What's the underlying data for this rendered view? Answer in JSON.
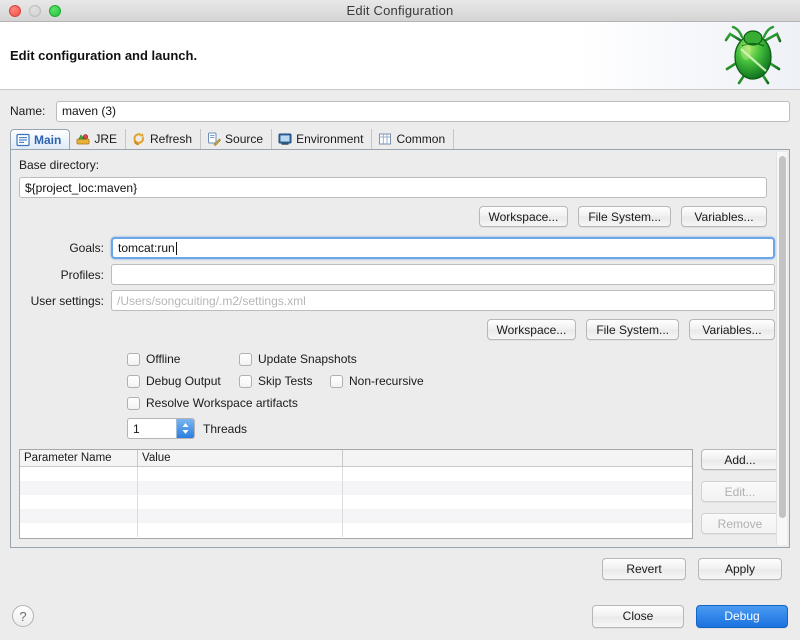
{
  "window": {
    "title": "Edit Configuration",
    "traffic_lights": [
      "close-button",
      "minimize-button",
      "zoom-button"
    ]
  },
  "header": {
    "title": "Edit configuration and launch.",
    "icon": "debug-bug-icon"
  },
  "name_field": {
    "label": "Name:",
    "value": "maven (3)"
  },
  "tabs": [
    {
      "label": "Main",
      "icon": "main-tab-icon",
      "active": true
    },
    {
      "label": "JRE",
      "icon": "jre-tab-icon",
      "active": false
    },
    {
      "label": "Refresh",
      "icon": "refresh-tab-icon",
      "active": false
    },
    {
      "label": "Source",
      "icon": "source-tab-icon",
      "active": false
    },
    {
      "label": "Environment",
      "icon": "environment-tab-icon",
      "active": false
    },
    {
      "label": "Common",
      "icon": "common-tab-icon",
      "active": false
    }
  ],
  "main_tab": {
    "base_directory": {
      "label": "Base directory:",
      "value": "${project_loc:maven}"
    },
    "locator_buttons_top": [
      {
        "label": "Workspace..."
      },
      {
        "label": "File System..."
      },
      {
        "label": "Variables..."
      }
    ],
    "goals": {
      "label": "Goals:",
      "value": "tomcat:run",
      "focused": true
    },
    "profiles": {
      "label": "Profiles:",
      "value": ""
    },
    "user_settings": {
      "label": "User settings:",
      "value": "",
      "placeholder": "/Users/songcuiting/.m2/settings.xml"
    },
    "locator_buttons_bottom": [
      {
        "label": "Workspace..."
      },
      {
        "label": "File System..."
      },
      {
        "label": "Variables..."
      }
    ],
    "checkboxes": [
      [
        {
          "label": "Offline",
          "checked": false
        },
        {
          "label": "Update Snapshots",
          "checked": false
        }
      ],
      [
        {
          "label": "Debug Output",
          "checked": false
        },
        {
          "label": "Skip Tests",
          "checked": false
        },
        {
          "label": "Non-recursive",
          "checked": false
        }
      ],
      [
        {
          "label": "Resolve Workspace artifacts",
          "checked": false
        }
      ]
    ],
    "threads": {
      "value": "1",
      "label": "Threads"
    },
    "parameters_table": {
      "columns": [
        "Parameter Name",
        "Value",
        ""
      ],
      "rows": []
    },
    "table_buttons": [
      {
        "label": "Add...",
        "enabled": true
      },
      {
        "label": "Edit...",
        "enabled": false
      },
      {
        "label": "Remove",
        "enabled": false
      }
    ]
  },
  "action_buttons": [
    {
      "label": "Revert"
    },
    {
      "label": "Apply"
    }
  ],
  "footer": {
    "help": "?",
    "buttons": [
      {
        "label": "Close",
        "primary": false
      },
      {
        "label": "Debug",
        "primary": true
      }
    ]
  },
  "colors": {
    "accent_blue": "#1a72e0",
    "tab_active_text": "#2b63b0",
    "focus_ring": "#6aa6e8",
    "dialog_bg": "#ececec"
  }
}
